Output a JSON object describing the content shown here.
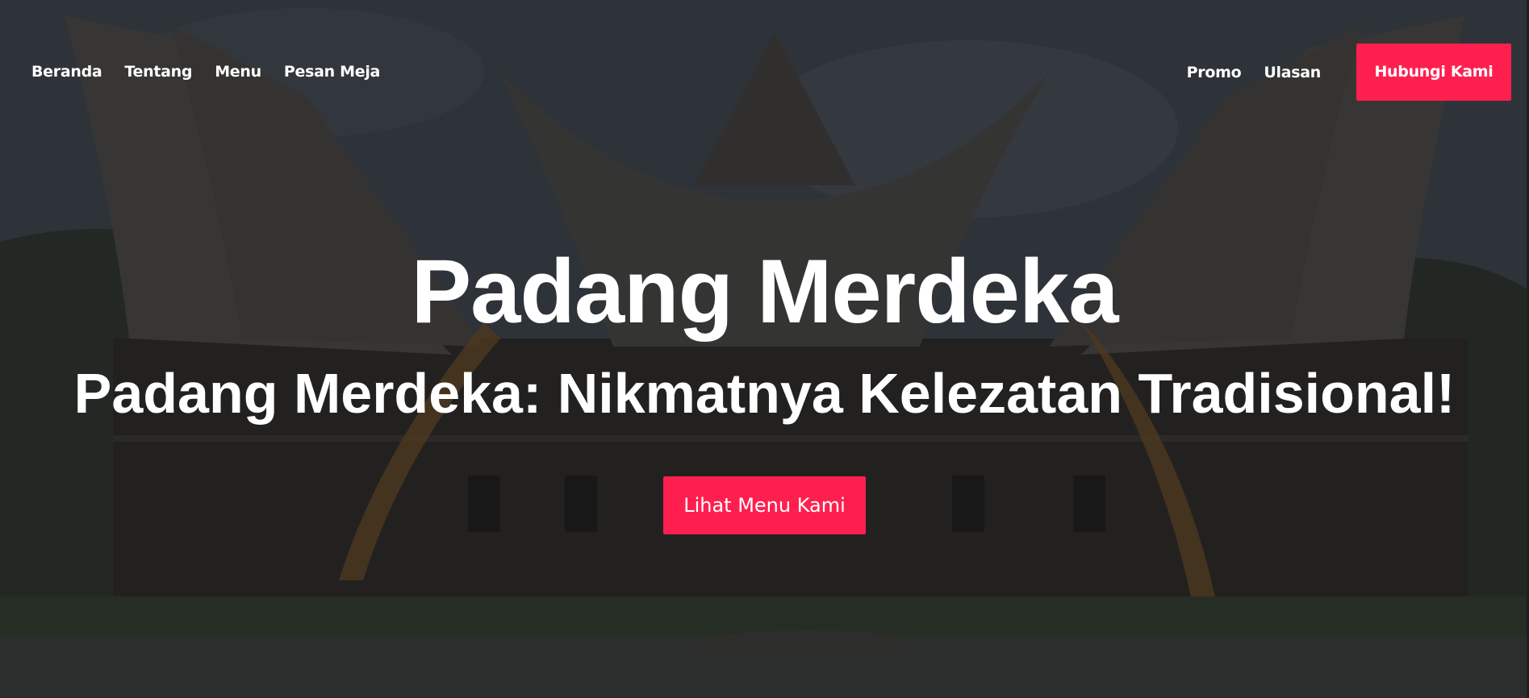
{
  "nav": {
    "left_items": [
      {
        "label": "Beranda"
      },
      {
        "label": "Tentang"
      },
      {
        "label": "Menu"
      },
      {
        "label": "Pesan Meja"
      }
    ],
    "right_items": [
      {
        "label": "Promo"
      },
      {
        "label": "Ulasan"
      }
    ],
    "contact_label": "Hubungi Kami"
  },
  "hero": {
    "title": "Padang Merdeka",
    "subtitle": "Padang Merdeka: Nikmatnya Kelezatan Tradisional!",
    "cta_label": "Lihat Menu Kami",
    "background": "rumah-gadang-photo"
  },
  "colors": {
    "accent": "#ff1f4f",
    "text": "#ffffff"
  }
}
